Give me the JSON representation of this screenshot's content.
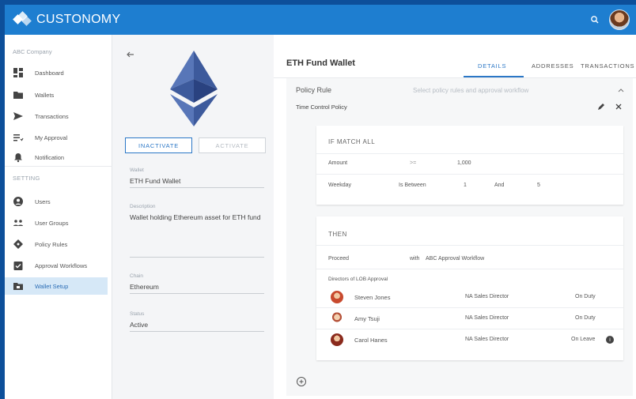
{
  "app": {
    "name": "CUSTONOMY"
  },
  "sidebar": {
    "company": "ABC Company",
    "setting_label": "SETTING",
    "items": [
      {
        "label": "Dashboard",
        "icon": "dashboard-icon"
      },
      {
        "label": "Wallets",
        "icon": "folder-icon"
      },
      {
        "label": "Transactions",
        "icon": "send-icon"
      },
      {
        "label": "My Approval",
        "icon": "list-icon"
      },
      {
        "label": "Notification",
        "icon": "bell-icon"
      }
    ],
    "settings": [
      {
        "label": "Users",
        "icon": "user-icon"
      },
      {
        "label": "User Groups",
        "icon": "group-icon"
      },
      {
        "label": "Policy Rules",
        "icon": "policy-icon"
      },
      {
        "label": "Approval Workflows",
        "icon": "check-icon"
      },
      {
        "label": "Wallet Setup",
        "icon": "folder-icon"
      }
    ]
  },
  "wallet_panel": {
    "inactivate_label": "INACTIVATE",
    "activate_label": "ACTIVATE",
    "fields": {
      "wallet": {
        "label": "Wallet",
        "value": "ETH Fund Wallet"
      },
      "description": {
        "label": "Description",
        "value": "Wallet holding Ethereum asset for ETH fund"
      },
      "chain": {
        "label": "Chain",
        "value": "Ethereum"
      },
      "status": {
        "label": "Status",
        "value": "Active"
      }
    }
  },
  "main": {
    "title": "ETH Fund Wallet",
    "tabs": [
      {
        "label": "DETAILS"
      },
      {
        "label": "ADDRESSES"
      },
      {
        "label": "TRANSACTIONS"
      }
    ],
    "policy": {
      "title": "Policy Rule",
      "hint": "Select policy rules and approval workflow",
      "name": "Time Control Policy",
      "if": {
        "heading": "IF MATCH ALL",
        "rows": [
          {
            "field": "Amount",
            "op": ">=",
            "value": "1,000",
            "joiner": "",
            "value2": ""
          },
          {
            "field": "Weekday",
            "op": "Is Between",
            "value": "1",
            "joiner": "And",
            "value2": "5"
          }
        ]
      },
      "then": {
        "heading": "THEN",
        "action": "Proceed",
        "with_label": "with",
        "workflow": "ABC Approval Workflow",
        "group": "Directors of LOB Approval",
        "approvers": [
          {
            "name": "Steven Jones",
            "role": "NA Sales Director",
            "status": "On Duty"
          },
          {
            "name": "Amy Tsuji",
            "role": "NA Sales Director",
            "status": "On Duty"
          },
          {
            "name": "Carol Hanes",
            "role": "NA Sales Director",
            "status": "On Leave",
            "info": "i"
          }
        ]
      }
    }
  },
  "colors": {
    "brand": "#1e7ed0",
    "accent": "#2b77c6",
    "active_bg": "#d6e8f7"
  }
}
